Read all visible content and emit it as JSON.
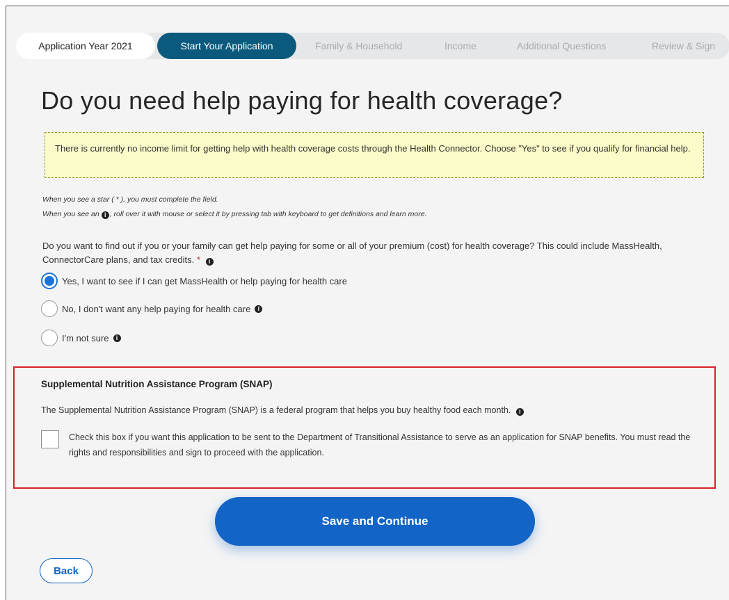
{
  "progress": {
    "year": "Application Year 2021",
    "steps": [
      "Start Your Application",
      "Family & Household",
      "Income",
      "Additional Questions",
      "Review & Sign"
    ],
    "active_index": 0
  },
  "page_title": "Do you need help paying for health coverage?",
  "notice": "There is currently no income limit for getting help with health coverage costs through the Health Connector. Choose \"Yes\" to see if you qualify for financial help.",
  "hints": {
    "star": "When you see a star ( * ), you must complete the field.",
    "info_before": "When you see an",
    "info_after": ", roll over it with mouse or select it by pressing tab with keyboard to get definitions and learn more."
  },
  "question": {
    "text": "Do you want to find out if you or your family can get help paying for some or all of your premium (cost) for health coverage? This could include MassHealth, ConnectorCare plans, and tax credits.",
    "required_marker": "*",
    "options": [
      {
        "label": "Yes, I want to see if I can get MassHealth or help paying for health care",
        "selected": true,
        "info": false
      },
      {
        "label": "No, I don't want any help paying for health care",
        "selected": false,
        "info": true
      },
      {
        "label": "I'm not sure",
        "selected": false,
        "info": true
      }
    ]
  },
  "snap": {
    "title": "Supplemental Nutrition Assistance Program (SNAP)",
    "description": "The Supplemental Nutrition Assistance Program (SNAP) is a federal program that helps you buy healthy food each month.",
    "checkbox_label": "Check this box if you want this application to be sent to the Department of Transitional Assistance to serve as an application for SNAP benefits. You must read the rights and responsibilities and sign to proceed with the application.",
    "checked": false
  },
  "buttons": {
    "save": "Save and Continue",
    "back": "Back"
  },
  "colors": {
    "active_step": "#0b5a7e",
    "primary": "#1264c6",
    "highlight_border": "#d9202a",
    "notice_bg": "#fbfbc9"
  }
}
